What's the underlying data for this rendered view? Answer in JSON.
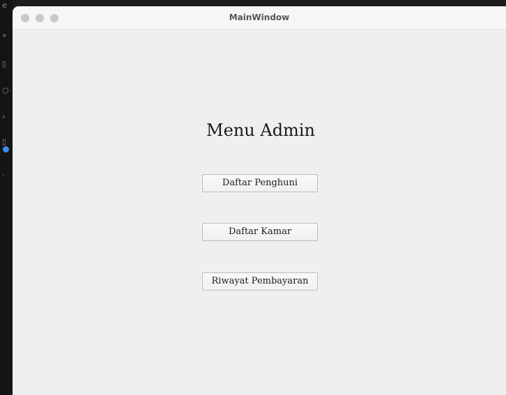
{
  "window": {
    "title": "MainWindow"
  },
  "background_app": {
    "edge_glyphs": [
      "e",
      "»",
      "▯",
      "○",
      "›",
      "▯",
      "·"
    ]
  },
  "main": {
    "heading": "Menu Admin",
    "buttons": [
      {
        "label": "Daftar Penghuni"
      },
      {
        "label": "Daftar Kamar"
      },
      {
        "label": "Riwayat Pembayaran"
      }
    ]
  }
}
